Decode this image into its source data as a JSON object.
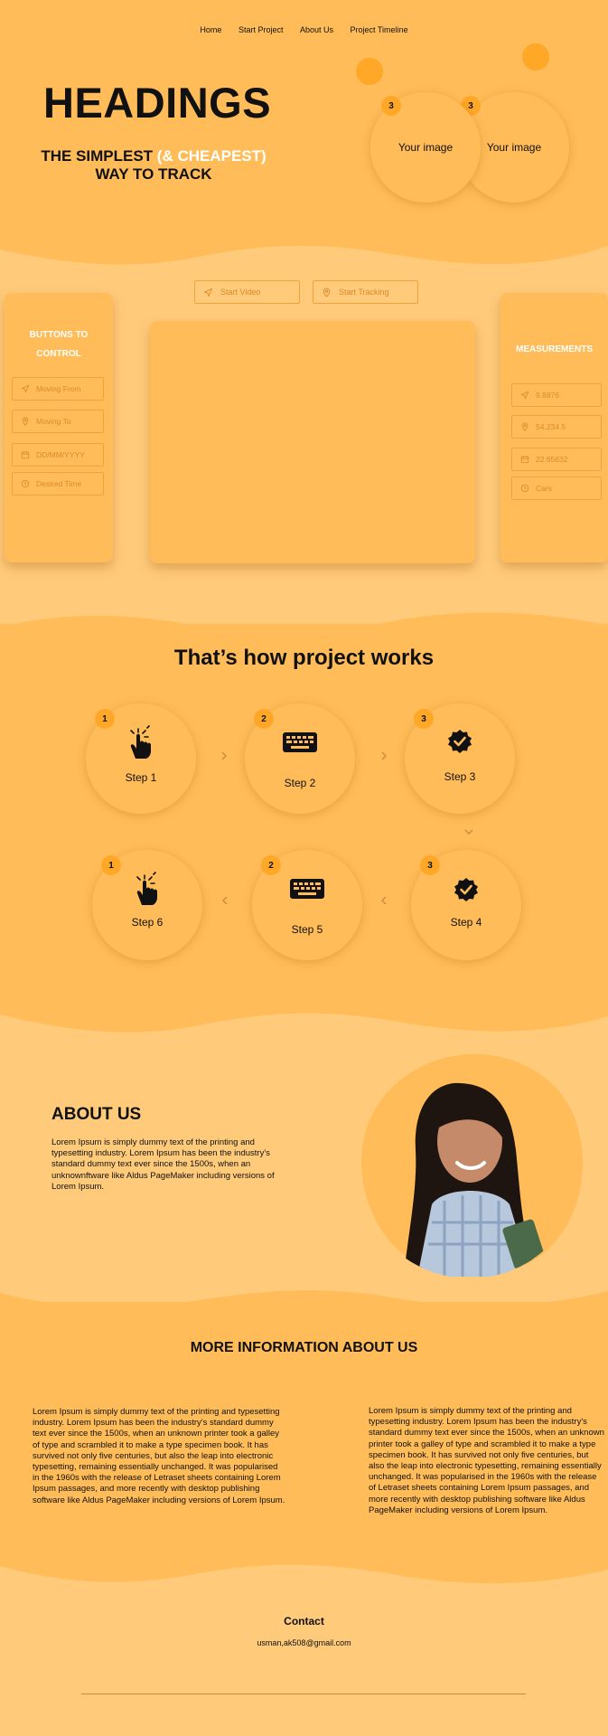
{
  "nav": {
    "items": [
      "Home",
      "Start Project",
      "About Us",
      "Project Timeline"
    ]
  },
  "hero": {
    "heading": "HEADINGS",
    "tagline_part1": "THE SIMPLEST ",
    "tagline_highlight": "(& CHEAPEST)",
    "tagline_part2": "WAY TO TRACK",
    "images": [
      {
        "badge": "3",
        "label": "Your image"
      },
      {
        "badge": "3",
        "label": "Your image"
      }
    ]
  },
  "controls": {
    "start_video": "Start Video",
    "start_tracking": "Start Tracking",
    "left_title_line1": "BUTTONS TO",
    "left_title_line2": "CONTROL",
    "inputs": [
      {
        "icon": "send-icon",
        "placeholder": "Moving From"
      },
      {
        "icon": "location-pin-icon",
        "placeholder": "Moving To"
      },
      {
        "icon": "calendar-icon",
        "placeholder": "DD/MM/YYYY"
      },
      {
        "icon": "clock-icon",
        "placeholder": "Desired Time"
      }
    ],
    "right_title": "MEASUREMENTS",
    "measurements": [
      {
        "icon": "send-icon",
        "value": "9.8876"
      },
      {
        "icon": "location-pin-icon",
        "value": "54.234.5"
      },
      {
        "icon": "calendar-icon",
        "value": "22.65632"
      },
      {
        "icon": "clock-icon",
        "value": "Cars"
      }
    ]
  },
  "how": {
    "title": "That’s how project  works",
    "steps": [
      {
        "badge": "1",
        "label": "Step 1",
        "icon": "hand-tap-icon"
      },
      {
        "badge": "2",
        "label": "Step 2",
        "icon": "keyboard-icon"
      },
      {
        "badge": "3",
        "label": "Step 3",
        "icon": "verified-badge-icon"
      },
      {
        "badge": "3",
        "label": "Step 4",
        "icon": "verified-badge-icon"
      },
      {
        "badge": "2",
        "label": "Step 5",
        "icon": "keyboard-icon"
      },
      {
        "badge": "1",
        "label": "Step 6",
        "icon": "hand-tap-icon"
      }
    ]
  },
  "about": {
    "title": "ABOUT US",
    "text": "Lorem Ipsum is simply dummy text of the printing and typesetting industry. Lorem Ipsum has been the industry's standard dummy text ever since the 1500s, when an unknownftware like Aldus PageMaker including versions of Lorem Ipsum."
  },
  "more": {
    "title": "MORE INFORMATION ABOUT US",
    "left_text": "Lorem Ipsum is simply dummy text of the printing and typesetting industry. Lorem Ipsum has been the industry's standard dummy text ever since the 1500s, when an unknown printer took a galley of type and scrambled it to make a type specimen book. It has survived not only five centuries, but also the leap into electronic typesetting, remaining essentially unchanged. It was popularised in the 1960s with the release of Letraset sheets containing Lorem Ipsum passages, and more recently with desktop publishing software like Aldus PageMaker including versions of Lorem Ipsum.",
    "right_text": "Lorem Ipsum is simply dummy text of the printing and typesetting industry. Lorem Ipsum has been the industry's standard dummy text ever since the 1500s, when an unknown printer took a galley of type and scrambled it to make a type specimen book. It has survived not only five centuries, but also the leap into electronic typesetting, remaining essentially unchanged. It was popularised in the 1960s with the release of Letraset sheets containing Lorem Ipsum passages, and more recently with desktop publishing software like Aldus PageMaker including versions of Lorem Ipsum."
  },
  "contact": {
    "title": "Contact",
    "email": "usman,ak508@gmail.com"
  },
  "colors": {
    "background_light": "#ffca7a",
    "background_dark": "#ffbc58",
    "accent": "#ffa726",
    "highlight_text": "#ffffff"
  }
}
